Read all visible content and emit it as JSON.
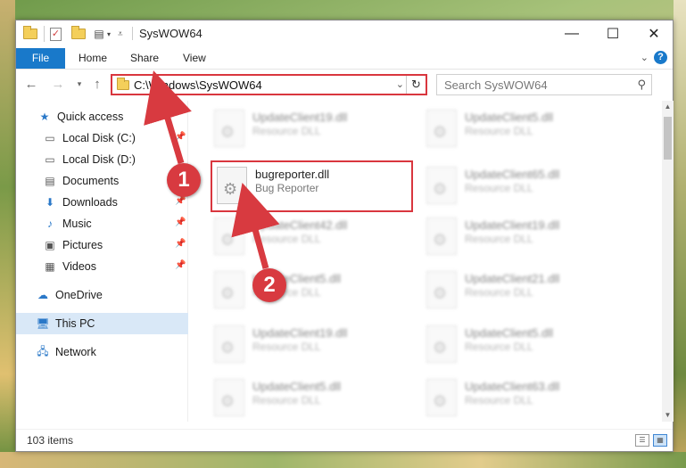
{
  "window": {
    "title": "SysWOW64"
  },
  "ribbon": {
    "tabs": [
      "File",
      "Home",
      "Share",
      "View"
    ],
    "help": "?"
  },
  "address": {
    "path": "C:\\Windows\\SysWOW64"
  },
  "search": {
    "placeholder": "Search SysWOW64"
  },
  "sidebar": {
    "items": [
      {
        "label": "Quick access",
        "icon": "star-icon"
      },
      {
        "label": "Local Disk (C:)",
        "icon": "drive-icon",
        "pinned": true
      },
      {
        "label": "Local Disk (D:)",
        "icon": "drive-icon",
        "pinned": false
      },
      {
        "label": "Documents",
        "icon": "documents-icon",
        "pinned": true
      },
      {
        "label": "Downloads",
        "icon": "download-icon",
        "pinned": true
      },
      {
        "label": "Music",
        "icon": "music-icon",
        "pinned": true
      },
      {
        "label": "Pictures",
        "icon": "pictures-icon",
        "pinned": true
      },
      {
        "label": "Videos",
        "icon": "videos-icon",
        "pinned": true
      },
      {
        "label": "OneDrive",
        "icon": "cloud-icon"
      },
      {
        "label": "This PC",
        "icon": "computer-icon",
        "selected": true
      },
      {
        "label": "Network",
        "icon": "network-icon"
      }
    ]
  },
  "files": [
    {
      "name": "UpdateClient19.dll",
      "desc": "Resource DLL",
      "blurred": true
    },
    {
      "name": "UpdateClient5.dll",
      "desc": "Resource DLL",
      "blurred": true
    },
    {
      "name": "bugreporter.dll",
      "desc": "Bug Reporter",
      "blurred": false
    },
    {
      "name": "UpdateClient65.dll",
      "desc": "Resource DLL",
      "blurred": true
    },
    {
      "name": "UpdateClient42.dll",
      "desc": "Resource DLL",
      "blurred": true
    },
    {
      "name": "UpdateClient19.dll",
      "desc": "Resource DLL",
      "blurred": true
    },
    {
      "name": "UpdateClient5.dll",
      "desc": "Resource DLL",
      "blurred": true
    },
    {
      "name": "UpdateClient21.dll",
      "desc": "Resource DLL",
      "blurred": true
    },
    {
      "name": "UpdateClient19.dll",
      "desc": "Resource DLL",
      "blurred": true
    },
    {
      "name": "UpdateClient5.dll",
      "desc": "Resource DLL",
      "blurred": true
    },
    {
      "name": "UpdateClient5.dll",
      "desc": "Resource DLL",
      "blurred": true
    },
    {
      "name": "UpdateClient63.dll",
      "desc": "Resource DLL",
      "blurred": true
    }
  ],
  "status": {
    "item_count": "103 items"
  },
  "annotations": {
    "badge1": "1",
    "badge2": "2",
    "color": "#d83a40"
  }
}
